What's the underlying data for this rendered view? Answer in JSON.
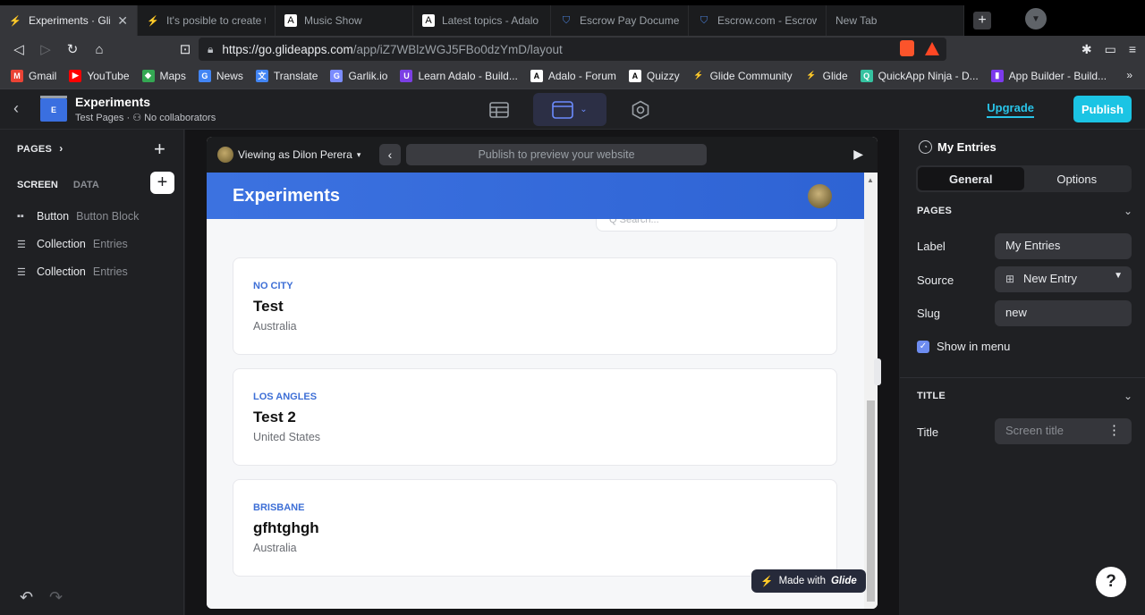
{
  "browser": {
    "tabs": [
      {
        "title": "Experiments · Glide",
        "icon": "glide-icon",
        "active": true
      },
      {
        "title": "It's posible to create thi",
        "icon": "glide-icon"
      },
      {
        "title": "Music Show",
        "icon": "adalo-icon"
      },
      {
        "title": "Latest topics - Adalo",
        "icon": "adalo-icon"
      },
      {
        "title": "Escrow Pay Documentati",
        "icon": "shield-icon"
      },
      {
        "title": "Escrow.com - Escrow.co",
        "icon": "shield-icon"
      },
      {
        "title": "New Tab",
        "icon": ""
      }
    ],
    "url_host": "https://go.glideapps.com",
    "url_path": "/app/iZ7WBlzWGJ5FBo0dzYmD/layout",
    "bookmarks": [
      {
        "label": "Gmail",
        "icon_color": "#ea4335",
        "glyph": "M"
      },
      {
        "label": "YouTube",
        "icon_color": "#ff0000",
        "glyph": "▶"
      },
      {
        "label": "Maps",
        "icon_color": "#34a853",
        "glyph": "◆"
      },
      {
        "label": "News",
        "icon_color": "#4285f4",
        "glyph": "G"
      },
      {
        "label": "Translate",
        "icon_color": "#4285f4",
        "glyph": "文"
      },
      {
        "label": "Garlik.io",
        "icon_color": "#7b8cff",
        "glyph": "G"
      },
      {
        "label": "Learn Adalo - Build...",
        "icon_color": "#7b3fe4",
        "glyph": "U"
      },
      {
        "label": "Adalo - Forum",
        "icon_color": "#ffffff",
        "glyph": "A"
      },
      {
        "label": "Quizzy",
        "icon_color": "#ffffff",
        "glyph": "A"
      },
      {
        "label": "Glide Community",
        "icon_color": "#202124",
        "glyph": "⚡"
      },
      {
        "label": "Glide",
        "icon_color": "#202124",
        "glyph": "⚡"
      },
      {
        "label": "QuickApp Ninja - D...",
        "icon_color": "#35c2a0",
        "glyph": "Q"
      },
      {
        "label": "App Builder - Build...",
        "icon_color": "#7c3aed",
        "glyph": "▮"
      }
    ],
    "bookmarks_more": "»"
  },
  "appbar": {
    "logo_letter": "E",
    "app_name": "Experiments",
    "subtitle": "Test Pages · ⚇ No collaborators",
    "upgrade": "Upgrade",
    "publish": "Publish"
  },
  "left": {
    "pages_label": "PAGES",
    "tab_screen": "SCREEN",
    "tab_data": "DATA",
    "components": [
      {
        "name": "Button",
        "type": "Button Block",
        "icon": "▪▪"
      },
      {
        "name": "Collection",
        "type": "Entries",
        "icon": "☰"
      },
      {
        "name": "Collection",
        "type": "Entries",
        "icon": "☰"
      }
    ]
  },
  "preview": {
    "viewing_as": "Viewing as Dilon Perera",
    "url_placeholder": "Publish to preview your website",
    "app_title": "Experiments",
    "search_placeholder": "Q Search...",
    "cards": [
      {
        "overline": "NO CITY",
        "title": "Test",
        "subtitle": "Australia"
      },
      {
        "overline": "LOS ANGLES",
        "title": "Test 2",
        "subtitle": "United States"
      },
      {
        "overline": "BRISBANE",
        "title": "gfhtghgh",
        "subtitle": "Australia"
      }
    ],
    "made_with": "Made with",
    "made_brand": "Glide"
  },
  "right": {
    "screen_name": "My Entries",
    "seg_general": "General",
    "seg_options": "Options",
    "pages_section": "PAGES",
    "label_label": "Label",
    "label_value": "My Entries",
    "source_label": "Source",
    "source_value": "New Entry",
    "slug_label": "Slug",
    "slug_value": "new",
    "show_in_menu": "Show in menu",
    "title_section": "TITLE",
    "title_label": "Title",
    "title_placeholder": "Screen title",
    "help": "?"
  }
}
